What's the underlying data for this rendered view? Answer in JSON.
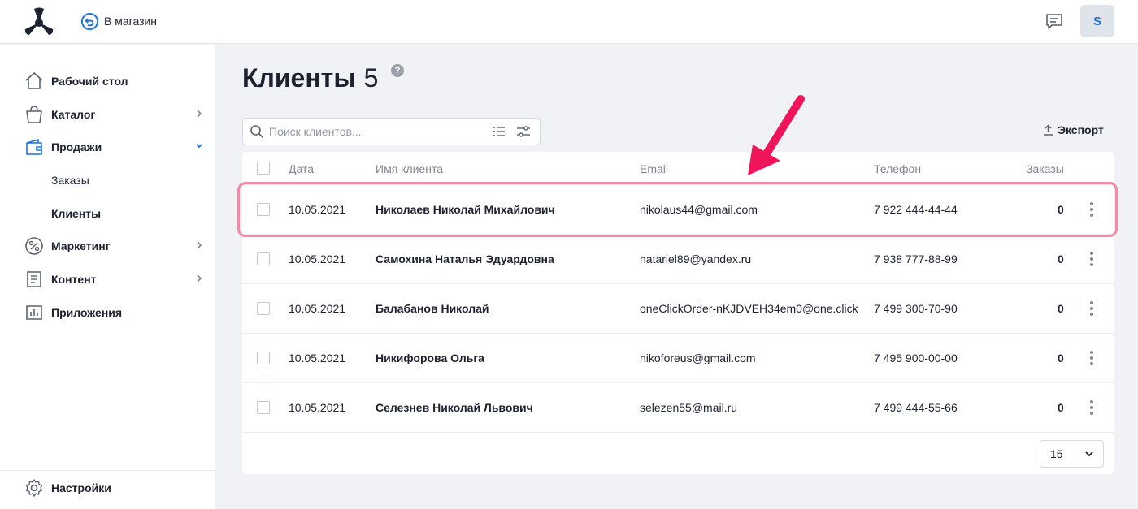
{
  "header": {
    "store_link": "В магазин",
    "avatar_letter": "S"
  },
  "sidebar": {
    "items": [
      {
        "label": "Рабочий стол",
        "icon": "home-icon"
      },
      {
        "label": "Каталог",
        "icon": "bag-icon"
      },
      {
        "label": "Продажи",
        "icon": "wallet-icon"
      },
      {
        "label": "Маркетинг",
        "icon": "percent-icon"
      },
      {
        "label": "Контент",
        "icon": "document-icon"
      },
      {
        "label": "Приложения",
        "icon": "chart-icon"
      }
    ],
    "sub_items": [
      {
        "label": "Заказы"
      },
      {
        "label": "Клиенты"
      }
    ],
    "settings": "Настройки"
  },
  "main": {
    "title": "Клиенты",
    "count": "5",
    "help": "?",
    "search_placeholder": "Поиск клиентов...",
    "export_label": "Экспорт",
    "columns": [
      "Дата",
      "Имя клиента",
      "Email",
      "Телефон",
      "Заказы"
    ],
    "rows": [
      {
        "date": "10.05.2021",
        "name": "Николаев Николай Михайлович",
        "email": "nikolaus44@gmail.com",
        "phone": "7 922 444-44-44",
        "orders": "0"
      },
      {
        "date": "10.05.2021",
        "name": "Самохина Наталья Эдуардовна",
        "email": "natariel89@yandex.ru",
        "phone": "7 938 777-88-99",
        "orders": "0"
      },
      {
        "date": "10.05.2021",
        "name": "Балабанов Николай",
        "email": "oneClickOrder-nKJDVEH34em0@one.click",
        "phone": "7 499 300-70-90",
        "orders": "0"
      },
      {
        "date": "10.05.2021",
        "name": "Никифорова Ольга",
        "email": "nikoforeus@gmail.com",
        "phone": "7 495 900-00-00",
        "orders": "0"
      },
      {
        "date": "10.05.2021",
        "name": "Селезнев Николай Львович",
        "email": "selezen55@mail.ru",
        "phone": "7 499 444-55-66",
        "orders": "0"
      }
    ],
    "page_size": "15"
  },
  "colors": {
    "accent": "#1a73d9",
    "highlight": "#f08aa5",
    "arrow": "#f0145a"
  }
}
